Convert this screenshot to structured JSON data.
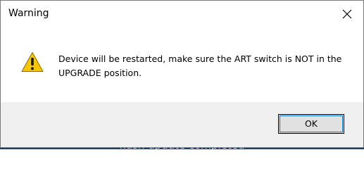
{
  "background_window": {
    "partial_text": "flash update completed"
  },
  "dialog": {
    "title": "Warning",
    "close_icon": "close-icon",
    "warning_icon": "warning-icon",
    "message": "Device will be restarted, make sure the ART switch is NOT in the UPGRADE position.",
    "ok_label": "OK"
  },
  "colors": {
    "warning_yellow": "#f7c600",
    "focus_border": "#0078d7",
    "footer_bg": "#f0f0f0"
  }
}
